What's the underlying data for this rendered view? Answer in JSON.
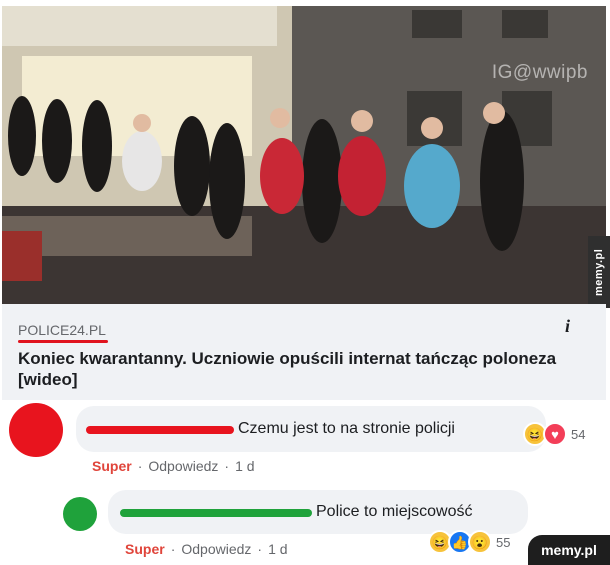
{
  "photo": {
    "watermark": "IG@wwipb"
  },
  "link_preview": {
    "source": "POLICE24.PL",
    "headline": "Koniec kwarantanny. Uczniowie opuścili internat tańcząc poloneza [wideo]",
    "info_icon": "i"
  },
  "side_watermark": "memy.pl",
  "comments": [
    {
      "text": "Czemu jest to na stronie policji",
      "reaction_icons": [
        "haha-icon",
        "love-icon"
      ],
      "reaction_count": "54",
      "actions": {
        "like": "Super",
        "reply": "Odpowiedz",
        "time": "1 d",
        "sep": "·"
      },
      "colors": {
        "avatar": "#e8141e",
        "name_bar": "#e8141e"
      }
    },
    {
      "text": "Police to miejscowość",
      "reaction_icons": [
        "haha-icon",
        "like-icon",
        "wow-icon"
      ],
      "reaction_count": "55",
      "actions": {
        "like": "Super",
        "reply": "Odpowiedz",
        "time": "1 d",
        "sep": "·"
      },
      "colors": {
        "avatar": "#1fa23b",
        "name_bar": "#1fa23b"
      }
    }
  ],
  "bottom_watermark": "memy.pl"
}
